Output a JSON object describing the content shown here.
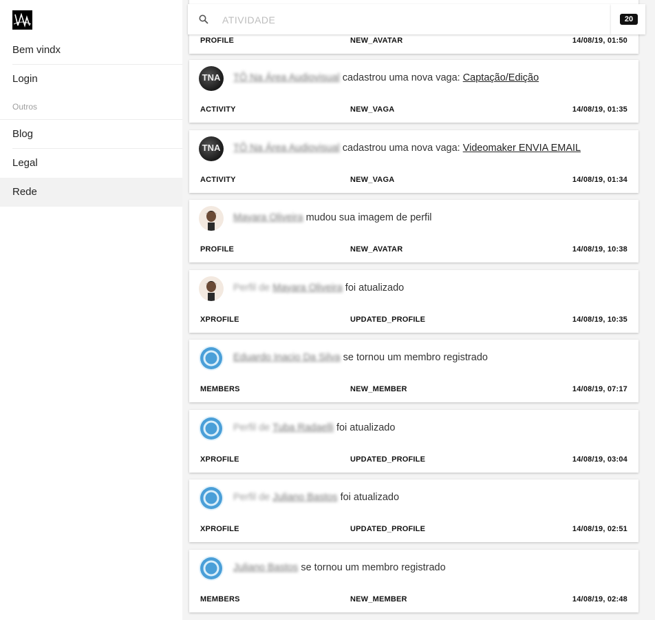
{
  "sidebar": {
    "logo_text": "VA",
    "items": [
      {
        "label": "Bem vindx"
      },
      {
        "label": "Login"
      }
    ],
    "section_label": "Outros",
    "items2": [
      {
        "label": "Blog"
      },
      {
        "label": "Legal"
      },
      {
        "label": "Rede"
      }
    ]
  },
  "search": {
    "placeholder": "ATIVIDADE",
    "value": ""
  },
  "count_badge": "20",
  "feed": [
    {
      "avatar": "partial",
      "prefix": "",
      "name": "",
      "text": "",
      "link": "",
      "component": "PROFILE",
      "type": "NEW_AVATAR",
      "date": "14/08/19, 01:50"
    },
    {
      "avatar": "dark",
      "avatar_text": "TNA",
      "prefix": "",
      "name": "TÔ Na Área Audiovisual",
      "text": "cadastrou uma nova vaga: ",
      "link": "Captação/Edição",
      "component": "ACTIVITY",
      "type": "NEW_VAGA",
      "date": "14/08/19, 01:35"
    },
    {
      "avatar": "dark",
      "avatar_text": "TNA",
      "prefix": "",
      "name": "TÔ Na Área Audiovisual",
      "text": "cadastrou uma nova vaga: ",
      "link": "Videomaker ENVIA EMAIL",
      "component": "ACTIVITY",
      "type": "NEW_VAGA",
      "date": "14/08/19, 01:34"
    },
    {
      "avatar": "person",
      "prefix": "",
      "name": "Mayara Oliveira",
      "text": "mudou sua imagem de perfil",
      "link": "",
      "component": "PROFILE",
      "type": "NEW_AVATAR",
      "date": "14/08/19, 10:38"
    },
    {
      "avatar": "person",
      "prefix": "Perfil de",
      "name": "Mayara Oliveira",
      "text": "foi atualizado",
      "link": "",
      "component": "XPROFILE",
      "type": "UPDATED_PROFILE",
      "date": "14/08/19, 10:35"
    },
    {
      "avatar": "blue",
      "prefix": "",
      "name": "Eduardo Inacio Da Silva",
      "text": "se tornou um membro registrado",
      "link": "",
      "component": "MEMBERS",
      "type": "NEW_MEMBER",
      "date": "14/08/19, 07:17"
    },
    {
      "avatar": "blue",
      "prefix": "Perfil de",
      "name": "Tuba Radaelli",
      "text": "foi atualizado",
      "link": "",
      "component": "XPROFILE",
      "type": "UPDATED_PROFILE",
      "date": "14/08/19, 03:04"
    },
    {
      "avatar": "blue",
      "prefix": "Perfil de",
      "name": "Juliano Bastos",
      "text": "foi atualizado",
      "link": "",
      "component": "XPROFILE",
      "type": "UPDATED_PROFILE",
      "date": "14/08/19, 02:51"
    },
    {
      "avatar": "blue",
      "prefix": "",
      "name": "Juliano Bastos",
      "text": "se tornou um membro registrado",
      "link": "",
      "component": "MEMBERS",
      "type": "NEW_MEMBER",
      "date": "14/08/19, 02:48"
    }
  ]
}
